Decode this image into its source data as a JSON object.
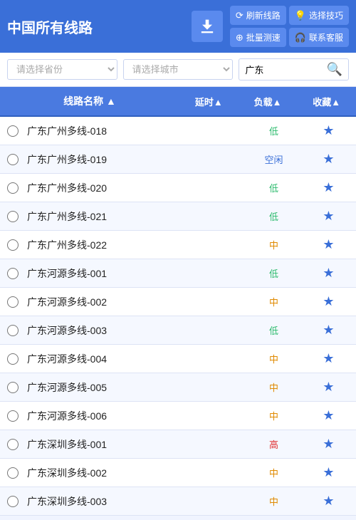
{
  "header": {
    "title": "中国所有线路",
    "btn_refresh": "刷新线路",
    "btn_tips": "选择技巧",
    "btn_batch": "批量测速",
    "btn_contact": "联系客服"
  },
  "filter": {
    "province_placeholder": "请选择省份",
    "city_placeholder": "请选择城市",
    "search_value": "广东"
  },
  "table": {
    "col_name": "线路名称 ▲",
    "col_delay": "延时▲",
    "col_load": "负载▲",
    "col_fav": "收藏▲",
    "rows": [
      {
        "name": "广东广州多线-018",
        "delay": "",
        "load": "低",
        "load_class": "low"
      },
      {
        "name": "广东广州多线-019",
        "delay": "",
        "load": "空闲",
        "load_class": "idle"
      },
      {
        "name": "广东广州多线-020",
        "delay": "",
        "load": "低",
        "load_class": "low"
      },
      {
        "name": "广东广州多线-021",
        "delay": "",
        "load": "低",
        "load_class": "low"
      },
      {
        "name": "广东广州多线-022",
        "delay": "",
        "load": "中",
        "load_class": "medium"
      },
      {
        "name": "广东河源多线-001",
        "delay": "",
        "load": "低",
        "load_class": "low"
      },
      {
        "name": "广东河源多线-002",
        "delay": "",
        "load": "中",
        "load_class": "medium"
      },
      {
        "name": "广东河源多线-003",
        "delay": "",
        "load": "低",
        "load_class": "low"
      },
      {
        "name": "广东河源多线-004",
        "delay": "",
        "load": "中",
        "load_class": "medium"
      },
      {
        "name": "广东河源多线-005",
        "delay": "",
        "load": "中",
        "load_class": "medium"
      },
      {
        "name": "广东河源多线-006",
        "delay": "",
        "load": "中",
        "load_class": "medium"
      },
      {
        "name": "广东深圳多线-001",
        "delay": "",
        "load": "高",
        "load_class": "high"
      },
      {
        "name": "广东深圳多线-002",
        "delay": "",
        "load": "中",
        "load_class": "medium"
      },
      {
        "name": "广东深圳多线-003",
        "delay": "",
        "load": "中",
        "load_class": "medium"
      }
    ]
  }
}
